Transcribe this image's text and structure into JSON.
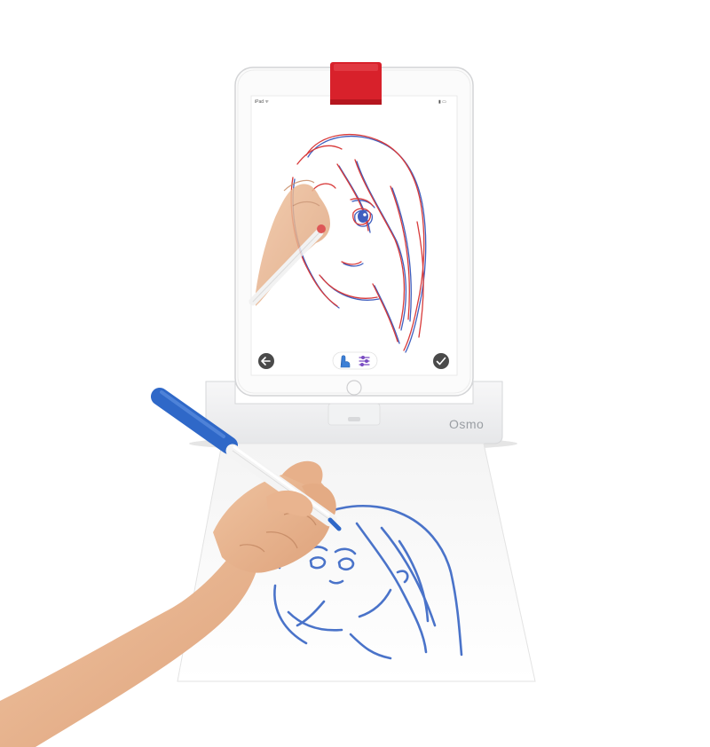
{
  "ipad": {
    "status_left": "iPad ᯤ",
    "status_right": "▮ ▭"
  },
  "app_toolbar": {
    "back_icon": "back-arrow-icon",
    "tool_icons": [
      "touch-hand-icon",
      "adjust-sliders-icon"
    ],
    "done_icon": "checkmark-icon"
  },
  "stand": {
    "brand": "Osmo"
  },
  "colors": {
    "clip_red": "#d8212b",
    "trace_red": "#d83a3a",
    "trace_blue": "#3f5fbf",
    "paper_blue": "#4a73c9",
    "marker_blue": "#2f68c8",
    "skin": "#e9b48f"
  }
}
